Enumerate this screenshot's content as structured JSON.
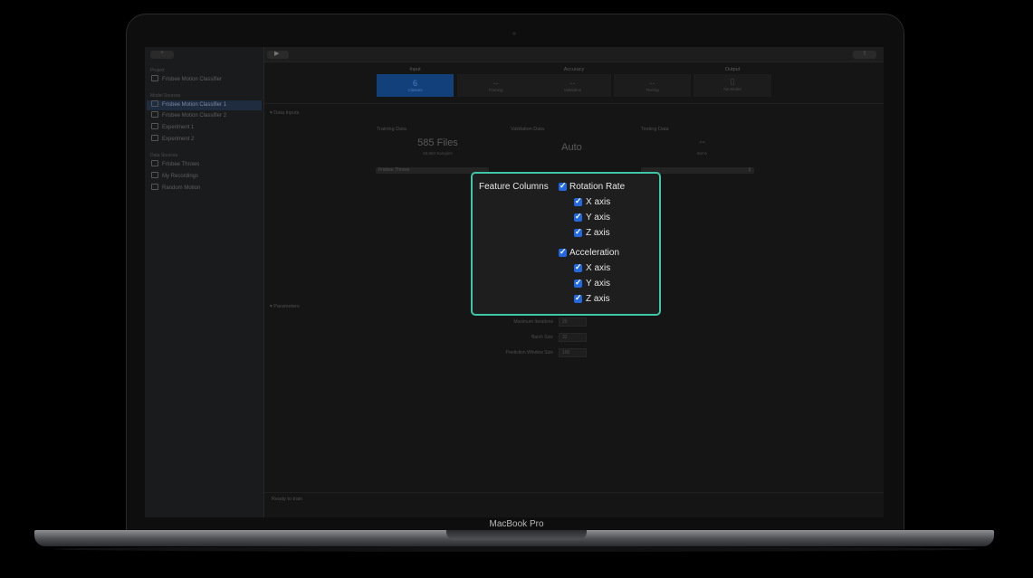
{
  "device": {
    "label": "MacBook Pro"
  },
  "sidebar": {
    "project_header": "Project",
    "project_item": "Frisbee Motion Classifier",
    "sources_header": "Model Sources",
    "sources": [
      "Frisbee Motion Classifier 1",
      "Frisbee Motion Classifier 2",
      "Experiment 1",
      "Experiment 2"
    ],
    "data_header": "Data Sources",
    "data_sources": [
      "Frisbee Throws",
      "My Recordings",
      "Random Motion"
    ]
  },
  "header": {
    "input": "Input",
    "accuracy": "Accuracy",
    "output": "Output"
  },
  "cards": {
    "input_value": "6",
    "input_caption": "Classes",
    "training_value": "--",
    "training_caption": "Training",
    "validation_value": "--",
    "validation_caption": "Validation",
    "testing_value": "--",
    "testing_caption": "Testing",
    "output_caption": "No Model"
  },
  "data_inputs": {
    "section": "Data Inputs",
    "training_label": "Training Data",
    "training_files": "585 Files",
    "training_samples": "93,963 Samples",
    "validation_label": "Validation Data",
    "validation_value": "Auto",
    "testing_label": "Testing Data",
    "testing_value": "--",
    "testing_caption": "Items",
    "training_popup": "Frisbee Throws"
  },
  "parameters": {
    "section": "Parameters",
    "max_iter_label": "Maximum Iterations",
    "max_iter": "20",
    "batch_label": "Batch Size",
    "batch": "32",
    "window_label": "Prediction Window Size",
    "window": "100"
  },
  "status": "Ready to train",
  "popover": {
    "title": "Feature Columns",
    "group1": "Rotation Rate",
    "group1_items": [
      "X axis",
      "Y axis",
      "Z axis"
    ],
    "group2": "Acceleration",
    "group2_items": [
      "X axis",
      "Y axis",
      "Z axis"
    ]
  },
  "colors": {
    "accent": "#3ec6a6",
    "checkbox": "#2468e0",
    "selection": "#1f2b3f"
  }
}
